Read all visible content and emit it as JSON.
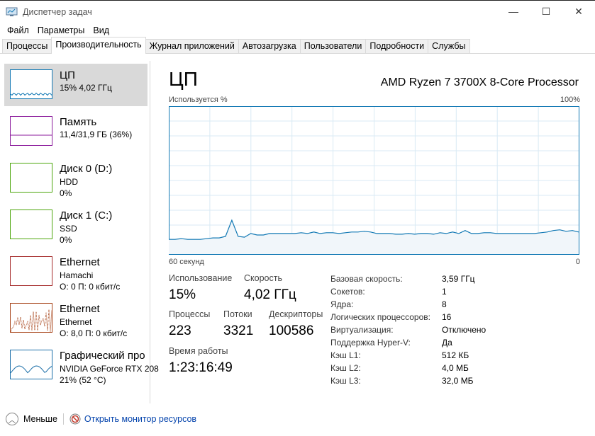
{
  "window": {
    "title": "Диспетчер задач",
    "minimize": "—",
    "maximize": "☐",
    "close": "✕"
  },
  "menu": [
    "Файл",
    "Параметры",
    "Вид"
  ],
  "tabs": [
    "Процессы",
    "Производительность",
    "Журнал приложений",
    "Автозагрузка",
    "Пользователи",
    "Подробности",
    "Службы"
  ],
  "sidebar": [
    {
      "title": "ЦП",
      "l2": "15% 4,02 ГГц",
      "l3": "",
      "color": "#1178b4"
    },
    {
      "title": "Память",
      "l2": "11,4/31,9 ГБ (36%)",
      "l3": "",
      "color": "#8b1a9b"
    },
    {
      "title": "Диск 0 (D:)",
      "l2": "HDD",
      "l3": "0%",
      "color": "#4da60c"
    },
    {
      "title": "Диск 1 (C:)",
      "l2": "SSD",
      "l3": "0%",
      "color": "#4da60c"
    },
    {
      "title": "Ethernet",
      "l2": "Hamachi",
      "l3": "О: 0 П: 0 кбит/с",
      "color": "#a52a2a"
    },
    {
      "title": "Ethernet",
      "l2": "Ethernet",
      "l3": "О: 8,0 П: 0 кбит/с",
      "color": "#a7441a"
    },
    {
      "title": "Графический про",
      "l2": "NVIDIA GeForce RTX 208",
      "l3": "21% (52 °C)",
      "color": "#1a6ea8"
    }
  ],
  "main": {
    "title": "ЦП",
    "cpu_name": "AMD Ryzen 7 3700X 8-Core Processor",
    "y_label": "Используется %",
    "y_max": "100%",
    "x_left": "60 секунд",
    "x_right": "0"
  },
  "stats": {
    "usage_label": "Использование",
    "usage": "15%",
    "speed_label": "Скорость",
    "speed": "4,02 ГГц",
    "proc_label": "Процессы",
    "proc": "223",
    "threads_label": "Потоки",
    "threads": "3321",
    "handles_label": "Дескрипторы",
    "handles": "100586",
    "uptime_label": "Время работы",
    "uptime": "1:23:16:49"
  },
  "details": [
    [
      "Базовая скорость:",
      "3,59 ГГц"
    ],
    [
      "Сокетов:",
      "1"
    ],
    [
      "Ядра:",
      "8"
    ],
    [
      "Логических процессоров:",
      "16"
    ],
    [
      "Виртуализация:",
      "Отключено"
    ],
    [
      "Поддержка Hyper-V:",
      "Да"
    ],
    [
      "Кэш L1:",
      "512 КБ"
    ],
    [
      "Кэш L2:",
      "4,0 МБ"
    ],
    [
      "Кэш L3:",
      "32,0 МБ"
    ]
  ],
  "footer": {
    "less": "Меньше",
    "monitor": "Открыть монитор ресурсов"
  },
  "chart_data": {
    "type": "line",
    "ylim": [
      0,
      100
    ],
    "xlim": [
      60,
      0
    ],
    "color": "#1178b4",
    "values": [
      10,
      10,
      10.5,
      10,
      10,
      10,
      10.5,
      11,
      11,
      12,
      23,
      12,
      11.5,
      14,
      13,
      13,
      14,
      14,
      14,
      14,
      14,
      14.5,
      14,
      15,
      14,
      14.5,
      14.5,
      14,
      14.5,
      15,
      15,
      15.5,
      15,
      14,
      14,
      14,
      13.5,
      13.5,
      14,
      13.5,
      14,
      14,
      13.5,
      14.5,
      14,
      15,
      14,
      16,
      14,
      14,
      14.5,
      14.5,
      14,
      14,
      14,
      14,
      14,
      14,
      14,
      14.5,
      15,
      16,
      16.5,
      15.5,
      16,
      15
    ]
  }
}
